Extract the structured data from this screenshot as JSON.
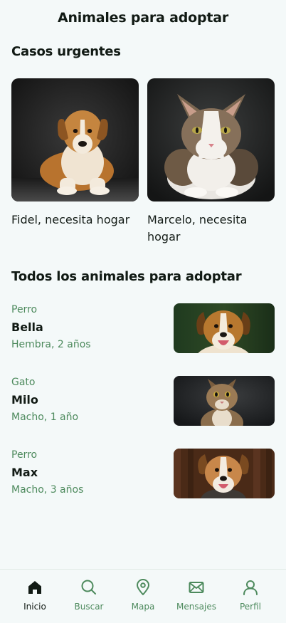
{
  "header": {
    "title": "Animales para adoptar"
  },
  "urgent": {
    "section_title": "Casos urgentes",
    "cards": [
      {
        "caption": "Fidel, necesita hogar",
        "image_icon": "dog-photo"
      },
      {
        "caption": "Marcelo, necesita hogar",
        "image_icon": "cat-photo"
      }
    ]
  },
  "all_animals": {
    "section_title": "Todos los animales para adoptar",
    "items": [
      {
        "type": "Perro",
        "name": "Bella",
        "details": "Hembra, 2 años",
        "image_icon": "dog-photo"
      },
      {
        "type": "Gato",
        "name": "Milo",
        "details": "Macho, 1 año",
        "image_icon": "cat-photo"
      },
      {
        "type": "Perro",
        "name": "Max",
        "details": "Macho, 3 años",
        "image_icon": "dog-photo"
      }
    ]
  },
  "bottom_nav": {
    "items": [
      {
        "label": "Inicio",
        "icon": "home-icon",
        "active": true
      },
      {
        "label": "Buscar",
        "icon": "search-icon",
        "active": false
      },
      {
        "label": "Mapa",
        "icon": "map-pin-icon",
        "active": false
      },
      {
        "label": "Mensajes",
        "icon": "mail-icon",
        "active": false
      },
      {
        "label": "Perfil",
        "icon": "user-icon",
        "active": false
      }
    ]
  },
  "colors": {
    "background": "#f4f9f9",
    "accent_green": "#4d8a5d",
    "text_dark": "#111a14"
  }
}
